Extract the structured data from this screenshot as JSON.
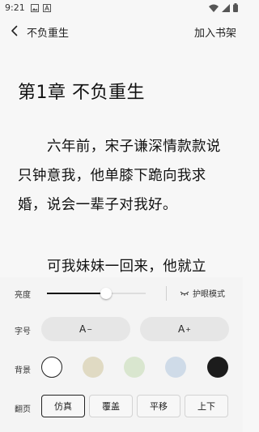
{
  "status": {
    "time": "9:21"
  },
  "topbar": {
    "title": "不负重生",
    "add_to_shelf": "加入书架"
  },
  "reader": {
    "chapter_title": "第1章 不负重生",
    "paragraphs": [
      "六年前，宋子谦深情款款说只钟意我，他单膝下跪向我求婚，说会一辈子对我好。",
      "可我妹妹一回来，他就立"
    ]
  },
  "settings": {
    "brightness": {
      "label": "亮度",
      "level": 0.6,
      "eye_mode_label": "护眼模式"
    },
    "font_size": {
      "label": "字号",
      "decrease": "A",
      "decrease_sup": "−",
      "increase": "A",
      "increase_sup": "+"
    },
    "background": {
      "label": "背景",
      "swatches": [
        {
          "name": "white",
          "color": "#ffffff",
          "selected": true
        },
        {
          "name": "beige",
          "color": "#e0dac3"
        },
        {
          "name": "green",
          "color": "#d9e6cf"
        },
        {
          "name": "blue",
          "color": "#cfdbe8"
        },
        {
          "name": "black",
          "color": "#1c1c1c"
        }
      ]
    },
    "page_turn": {
      "label": "翻页",
      "options": [
        "仿真",
        "覆盖",
        "平移",
        "上下"
      ],
      "selected": "仿真"
    }
  }
}
